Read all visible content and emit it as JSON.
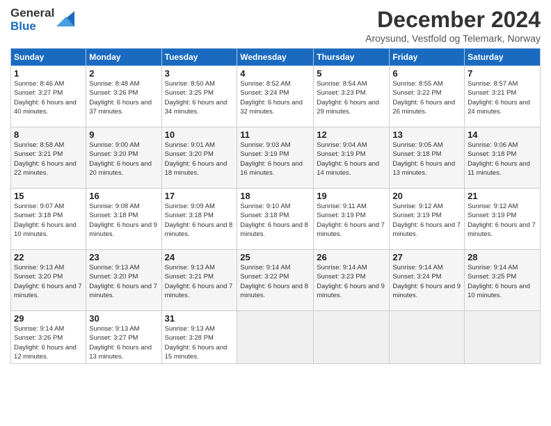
{
  "logo": {
    "general": "General",
    "blue": "Blue"
  },
  "title": "December 2024",
  "subtitle": "Aroysund, Vestfold og Telemark, Norway",
  "headers": [
    "Sunday",
    "Monday",
    "Tuesday",
    "Wednesday",
    "Thursday",
    "Friday",
    "Saturday"
  ],
  "weeks": [
    [
      {
        "day": "1",
        "sunrise": "8:46 AM",
        "sunset": "3:27 PM",
        "daylight": "6 hours and 40 minutes."
      },
      {
        "day": "2",
        "sunrise": "8:48 AM",
        "sunset": "3:26 PM",
        "daylight": "6 hours and 37 minutes."
      },
      {
        "day": "3",
        "sunrise": "8:50 AM",
        "sunset": "3:25 PM",
        "daylight": "6 hours and 34 minutes."
      },
      {
        "day": "4",
        "sunrise": "8:52 AM",
        "sunset": "3:24 PM",
        "daylight": "6 hours and 32 minutes."
      },
      {
        "day": "5",
        "sunrise": "8:54 AM",
        "sunset": "3:23 PM",
        "daylight": "6 hours and 29 minutes."
      },
      {
        "day": "6",
        "sunrise": "8:55 AM",
        "sunset": "3:22 PM",
        "daylight": "6 hours and 26 minutes."
      },
      {
        "day": "7",
        "sunrise": "8:57 AM",
        "sunset": "3:21 PM",
        "daylight": "6 hours and 24 minutes."
      }
    ],
    [
      {
        "day": "8",
        "sunrise": "8:58 AM",
        "sunset": "3:21 PM",
        "daylight": "6 hours and 22 minutes."
      },
      {
        "day": "9",
        "sunrise": "9:00 AM",
        "sunset": "3:20 PM",
        "daylight": "6 hours and 20 minutes."
      },
      {
        "day": "10",
        "sunrise": "9:01 AM",
        "sunset": "3:20 PM",
        "daylight": "6 hours and 18 minutes."
      },
      {
        "day": "11",
        "sunrise": "9:03 AM",
        "sunset": "3:19 PM",
        "daylight": "6 hours and 16 minutes."
      },
      {
        "day": "12",
        "sunrise": "9:04 AM",
        "sunset": "3:19 PM",
        "daylight": "6 hours and 14 minutes."
      },
      {
        "day": "13",
        "sunrise": "9:05 AM",
        "sunset": "3:18 PM",
        "daylight": "6 hours and 13 minutes."
      },
      {
        "day": "14",
        "sunrise": "9:06 AM",
        "sunset": "3:18 PM",
        "daylight": "6 hours and 11 minutes."
      }
    ],
    [
      {
        "day": "15",
        "sunrise": "9:07 AM",
        "sunset": "3:18 PM",
        "daylight": "6 hours and 10 minutes."
      },
      {
        "day": "16",
        "sunrise": "9:08 AM",
        "sunset": "3:18 PM",
        "daylight": "6 hours and 9 minutes."
      },
      {
        "day": "17",
        "sunrise": "9:09 AM",
        "sunset": "3:18 PM",
        "daylight": "6 hours and 8 minutes."
      },
      {
        "day": "18",
        "sunrise": "9:10 AM",
        "sunset": "3:18 PM",
        "daylight": "6 hours and 8 minutes."
      },
      {
        "day": "19",
        "sunrise": "9:11 AM",
        "sunset": "3:19 PM",
        "daylight": "6 hours and 7 minutes."
      },
      {
        "day": "20",
        "sunrise": "9:12 AM",
        "sunset": "3:19 PM",
        "daylight": "6 hours and 7 minutes."
      },
      {
        "day": "21",
        "sunrise": "9:12 AM",
        "sunset": "3:19 PM",
        "daylight": "6 hours and 7 minutes."
      }
    ],
    [
      {
        "day": "22",
        "sunrise": "9:13 AM",
        "sunset": "3:20 PM",
        "daylight": "6 hours and 7 minutes."
      },
      {
        "day": "23",
        "sunrise": "9:13 AM",
        "sunset": "3:20 PM",
        "daylight": "6 hours and 7 minutes."
      },
      {
        "day": "24",
        "sunrise": "9:13 AM",
        "sunset": "3:21 PM",
        "daylight": "6 hours and 7 minutes."
      },
      {
        "day": "25",
        "sunrise": "9:14 AM",
        "sunset": "3:22 PM",
        "daylight": "6 hours and 8 minutes."
      },
      {
        "day": "26",
        "sunrise": "9:14 AM",
        "sunset": "3:23 PM",
        "daylight": "6 hours and 9 minutes."
      },
      {
        "day": "27",
        "sunrise": "9:14 AM",
        "sunset": "3:24 PM",
        "daylight": "6 hours and 9 minutes."
      },
      {
        "day": "28",
        "sunrise": "9:14 AM",
        "sunset": "3:25 PM",
        "daylight": "6 hours and 10 minutes."
      }
    ],
    [
      {
        "day": "29",
        "sunrise": "9:14 AM",
        "sunset": "3:26 PM",
        "daylight": "6 hours and 12 minutes."
      },
      {
        "day": "30",
        "sunrise": "9:13 AM",
        "sunset": "3:27 PM",
        "daylight": "6 hours and 13 minutes."
      },
      {
        "day": "31",
        "sunrise": "9:13 AM",
        "sunset": "3:28 PM",
        "daylight": "6 hours and 15 minutes."
      },
      null,
      null,
      null,
      null
    ]
  ],
  "labels": {
    "sunrise": "Sunrise:",
    "sunset": "Sunset:",
    "daylight": "Daylight:"
  },
  "colors": {
    "header_bg": "#1a6bbf",
    "header_text": "#ffffff",
    "accent": "#1a6bbf"
  }
}
